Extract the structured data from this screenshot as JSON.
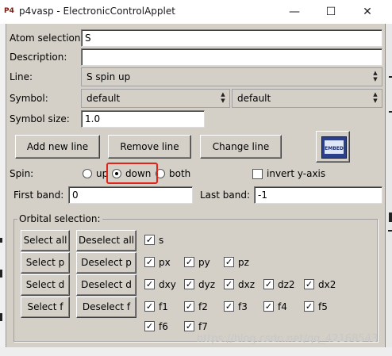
{
  "window": {
    "title": "p4vasp - ElectronicControlApplet",
    "app_icon_text": "P4",
    "minimize_glyph": "—",
    "maximize_glyph": "☐",
    "close_glyph": "✕"
  },
  "form": {
    "atom_selection_label": "Atom selection:",
    "atom_selection_value": "S",
    "description_label": "Description:",
    "description_value": "",
    "line_label": "Line:",
    "line_value": "S spin up",
    "symbol_label": "Symbol:",
    "symbol_value_1": "default",
    "symbol_value_2": "default",
    "symbol_size_label": "Symbol size:",
    "symbol_size_value": "1.0"
  },
  "buttons": {
    "add_new_line": "Add new line",
    "remove_line": "Remove line",
    "change_line": "Change line",
    "embed_icon_text": "EMBED"
  },
  "spin": {
    "label": "Spin:",
    "options": [
      "up",
      "down",
      "both"
    ],
    "selected": "down",
    "invert_y_axis_label": "invert y-axis",
    "invert_y_axis_checked": false
  },
  "bands": {
    "first_band_label": "First band:",
    "first_band_value": "0",
    "last_band_label": "Last band:",
    "last_band_value": "-1"
  },
  "orbital": {
    "legend": "Orbital selection:",
    "select_all": "Select all",
    "deselect_all": "Deselect all",
    "select_p": "Select p",
    "deselect_p": "Deselect p",
    "select_d": "Select d",
    "deselect_d": "Deselect d",
    "select_f": "Select f",
    "deselect_f": "Deselect f",
    "s_orbitals": [
      "s"
    ],
    "p_orbitals": [
      "px",
      "py",
      "pz"
    ],
    "d_orbitals": [
      "dxy",
      "dyz",
      "dxz",
      "dz2",
      "dx2"
    ],
    "f_orbitals_row1": [
      "f1",
      "f2",
      "f3",
      "f4",
      "f5"
    ],
    "f_orbitals_row2": [
      "f6",
      "f7"
    ],
    "check_glyph": "✓"
  },
  "watermark": "https://blog.csdn.net/qq_42168543"
}
